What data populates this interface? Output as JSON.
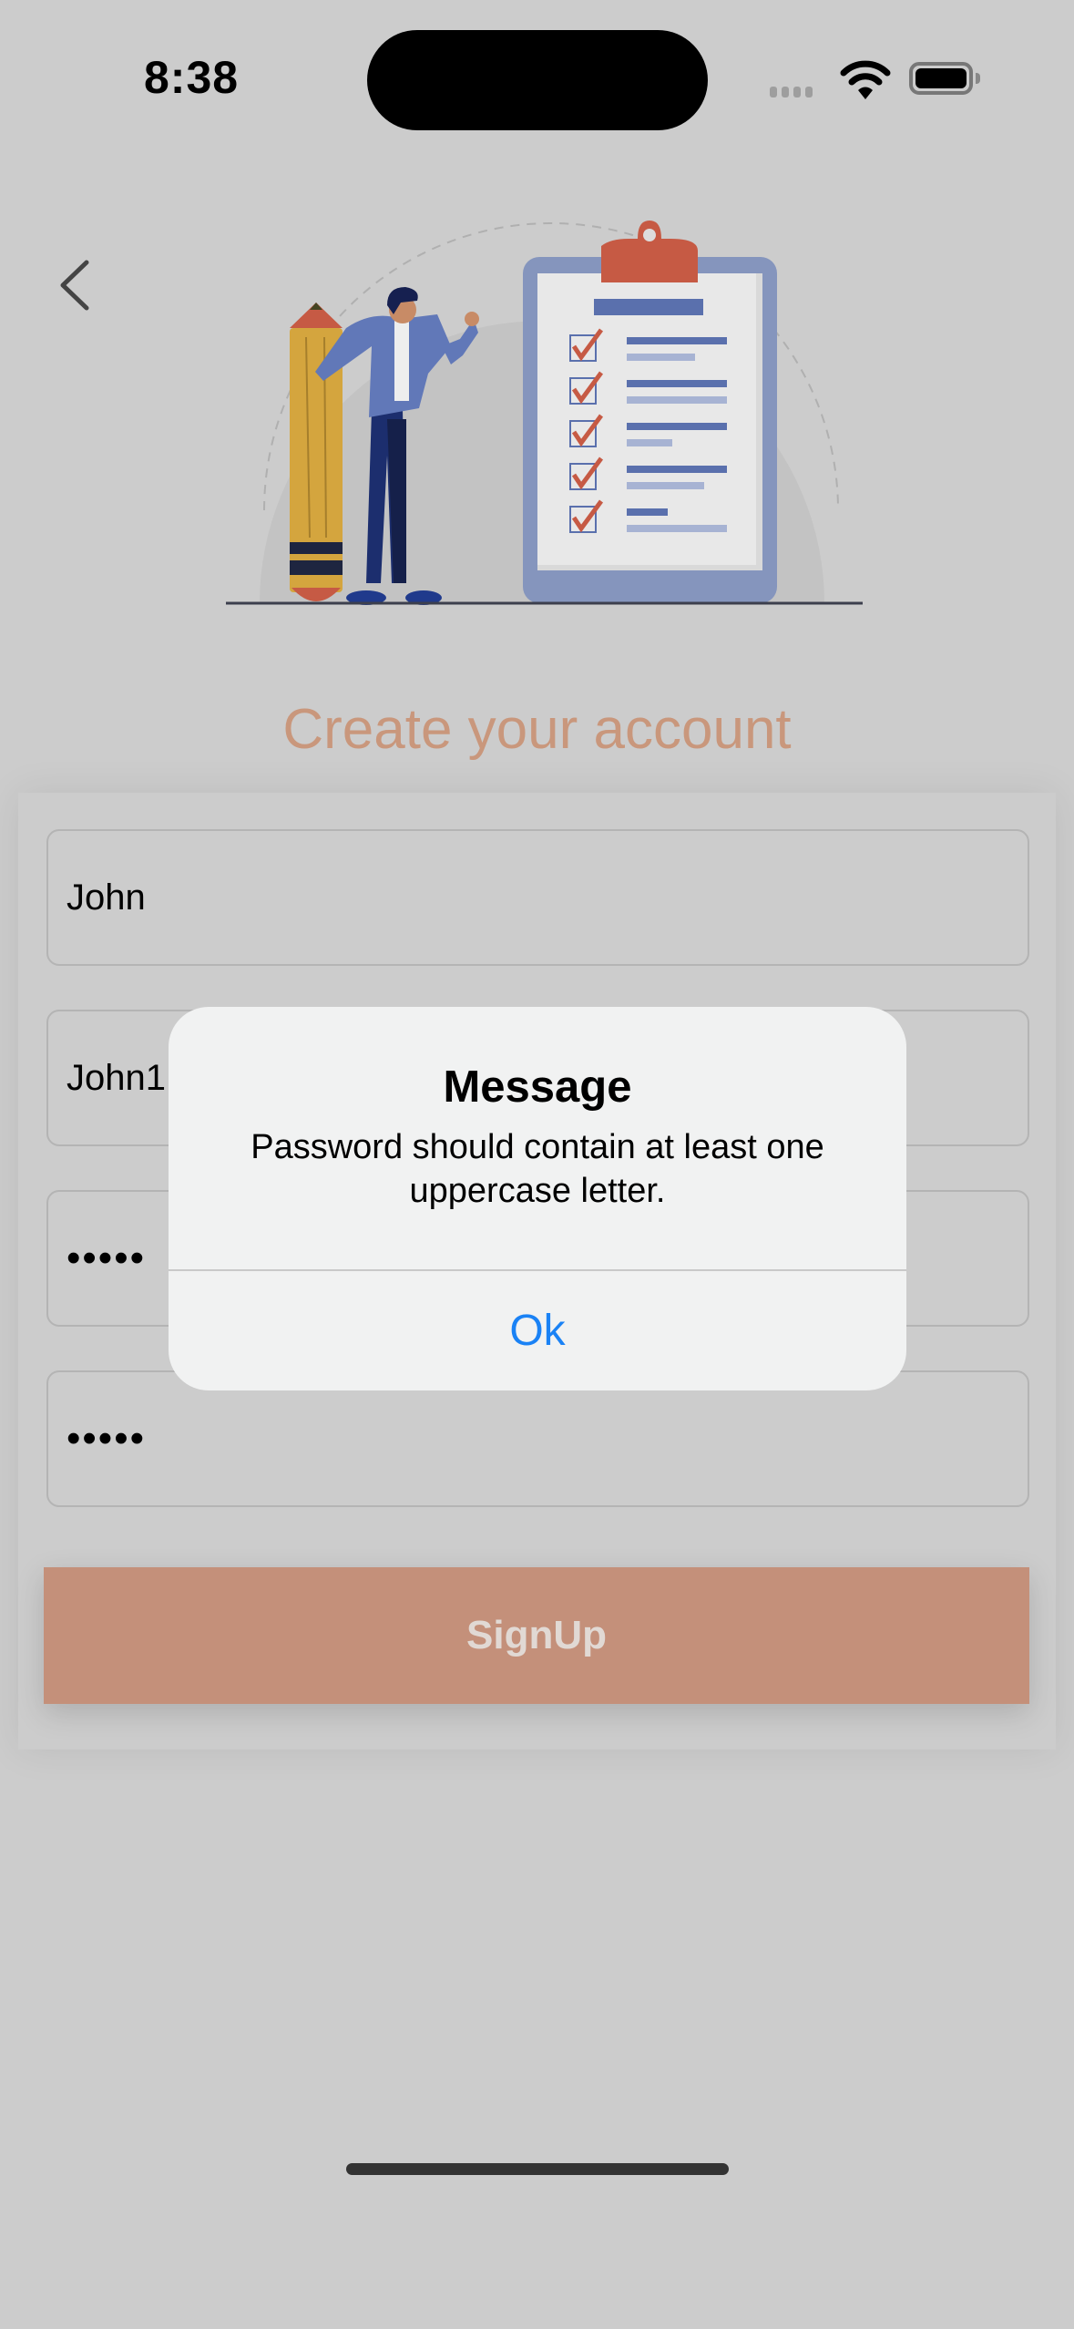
{
  "status_bar": {
    "time": "8:38"
  },
  "page": {
    "title": "Create your account"
  },
  "form": {
    "first_name": "John",
    "username": "John1",
    "password": "•••••",
    "confirm_password": "•••••",
    "signup_label": "SignUp"
  },
  "alert": {
    "title": "Message",
    "message": "Password should contain at least one uppercase letter.",
    "ok_label": "Ok"
  },
  "colors": {
    "accent": "#c4907a",
    "alert_button": "#1a82f5",
    "title": "#c9977c"
  }
}
